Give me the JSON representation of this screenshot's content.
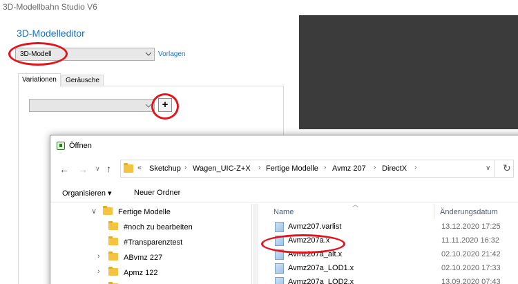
{
  "app": {
    "title": "3D-Modellbahn Studio V6"
  },
  "editor": {
    "title": "3D-Modelleditor",
    "model_select_value": "3D-Modell",
    "templates_link": "Vorlagen",
    "tabs": [
      {
        "label": "Variationen"
      },
      {
        "label": "Geräusche"
      }
    ],
    "variation_select_value": "",
    "add_button_label": "+"
  },
  "dialog": {
    "title": "Öffnen",
    "breadcrumbs": [
      {
        "label": "Sketchup"
      },
      {
        "label": "Wagen_UIC-Z+X"
      },
      {
        "label": "Fertige Modelle"
      },
      {
        "label": "Avmz 207"
      },
      {
        "label": "DirectX"
      }
    ],
    "overflow_label": "«",
    "toolbar": {
      "organize_label": "Organisieren ▾",
      "new_folder_label": "Neuer Ordner"
    },
    "nav_tree": [
      {
        "label": "Fertige Modelle"
      },
      {
        "label": "#noch zu bearbeiten"
      },
      {
        "label": "#Transparenztest"
      },
      {
        "label": "ABvmz 227"
      },
      {
        "label": "Apmz 122"
      }
    ],
    "file_list": {
      "columns": [
        {
          "label": "Name"
        },
        {
          "label": "Änderungsdatum"
        }
      ],
      "rows": [
        {
          "name": "Avmz207.varlist",
          "date": "13.12.2020 17:25"
        },
        {
          "name": "Avmz207a.x",
          "date": "11.11.2020 16:32"
        },
        {
          "name": "Avmz207a_alt.x",
          "date": "02.10.2020 21:42"
        },
        {
          "name": "Avmz207a_LOD1.x",
          "date": "02.10.2020 17:33"
        },
        {
          "name": "Avmz207a_LOD2.x",
          "date": "13.09.2020 07:43"
        }
      ]
    }
  },
  "colors": {
    "accent": "#1a6fc0",
    "annotation": "#e0151e",
    "preview_bg": "#3b3b3b"
  }
}
